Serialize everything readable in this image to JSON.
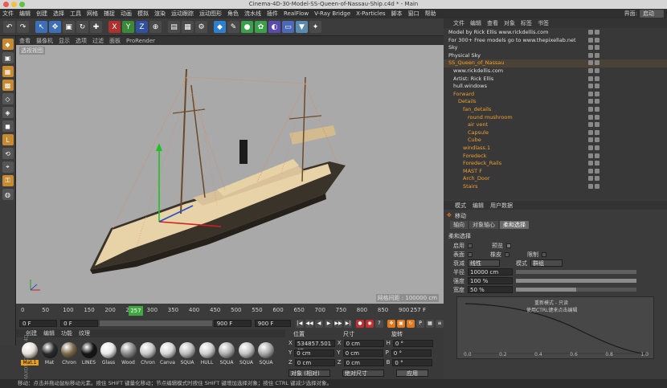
{
  "window": {
    "title": "Cinema-4D-30-Model-SS-Queen-of-Nassau-Ship.c4d * - Main"
  },
  "menubar": {
    "items": [
      "文件",
      "编辑",
      "创建",
      "选择",
      "工具",
      "网格",
      "捕捉",
      "动画",
      "模拟",
      "渲染",
      "运动跟踪",
      "运动图形",
      "角色",
      "流水线",
      "插件",
      "RealFlow",
      "V-Ray Bridge",
      "X-Particles",
      "脚本",
      "窗口",
      "帮助"
    ],
    "layout_label": "界面:",
    "layout_value": "启动"
  },
  "viewport": {
    "menu": [
      "查看",
      "摄像机",
      "显示",
      "选项",
      "过滤",
      "面板",
      "ProRender"
    ],
    "label": "透视视图",
    "grid_spacing": "网格间距 : 100000 cm"
  },
  "timeline": {
    "ticks": [
      "0",
      "50",
      "100",
      "150",
      "200",
      "250",
      "300",
      "350",
      "400",
      "450",
      "500",
      "550",
      "600",
      "650",
      "700",
      "750",
      "800",
      "850",
      "900"
    ],
    "current_frame": "257",
    "end_frame_display": "257 F",
    "start_field": "0 F",
    "range_start": "0 F",
    "range_end": "900 F",
    "max_field": "900 F",
    "playhead_fraction": 0.2856
  },
  "materials": {
    "menu": [
      "创建",
      "编辑",
      "功能",
      "纹理"
    ],
    "items": [
      {
        "label": "Mat.1",
        "color": "#e7e2d8"
      },
      {
        "label": "Mat",
        "color": "#2a2a2a"
      },
      {
        "label": "Chron",
        "color": "#7a6a4a"
      },
      {
        "label": "LINES",
        "color": "#151515"
      },
      {
        "label": "Glass",
        "color": "#e8e8e8"
      },
      {
        "label": "Wood",
        "color": "#8a8a8a"
      },
      {
        "label": "Chron",
        "color": "#c9c9c9"
      },
      {
        "label": "Canva",
        "color": "#d6d6d6"
      },
      {
        "label": "SQUA",
        "color": "#bdbdbd"
      },
      {
        "label": "HULL",
        "color": "#cfcfcf"
      },
      {
        "label": "SQUA",
        "color": "#b0b0b0"
      },
      {
        "label": "SQUA",
        "color": "#c4c4c4"
      },
      {
        "label": "SQUA",
        "color": "#a9a9a9"
      }
    ],
    "brand": "MAXON CINEMA 4D"
  },
  "coordinates": {
    "headers": {
      "position": "位置",
      "size": "尺寸",
      "rotation": "旋转"
    },
    "rows": [
      {
        "axis": "X",
        "pos": "534857.501 cn",
        "size_axis": "X",
        "size": "0 cm",
        "rot_axis": "H",
        "rot": "0 °"
      },
      {
        "axis": "Y",
        "pos": "0 cm",
        "size_axis": "Y",
        "size": "0 cm",
        "rot_axis": "P",
        "rot": "0 °"
      },
      {
        "axis": "Z",
        "pos": "0 cm",
        "size_axis": "Z",
        "size": "0 cm",
        "rot_axis": "B",
        "rot": "0 °"
      }
    ],
    "mode_select": "对象 (相对)",
    "size_select": "绝对尺寸",
    "apply_button": "应用"
  },
  "status": {
    "text": "移动：点击并拖动鼠标移动元素。按住 SHIFT 键量化移动；节点编辑模式时按住 SHIFT 键增加选择对象；按住 CTRL 键减少选择对象。"
  },
  "object_manager": {
    "menu": [
      "文件",
      "编辑",
      "查看",
      "对象",
      "标签",
      "书签"
    ],
    "objects": [
      {
        "name": "Model by Rick Ellis www.rickdellis.com",
        "indent": 0,
        "color": "#e0e0e0"
      },
      {
        "name": "For 300+ Free models go to www.thepixellab.net",
        "indent": 0,
        "color": "#e0e0e0"
      },
      {
        "name": "Sky",
        "indent": 0,
        "color": "#e0e0e0"
      },
      {
        "name": "Physical Sky",
        "indent": 0,
        "color": "#e0e0e0"
      },
      {
        "name": "SS_Queen_of_Nassau",
        "indent": 0,
        "color": "#f0a030"
      },
      {
        "name": "www.rickdellis.com",
        "indent": 1,
        "color": "#e0e0e0"
      },
      {
        "name": "Artist: Rick Ellis",
        "indent": 1,
        "color": "#e0e0e0"
      },
      {
        "name": "hull.windows",
        "indent": 1,
        "color": "#e0e0e0"
      },
      {
        "name": "Forward",
        "indent": 1,
        "color": "#f0a030"
      },
      {
        "name": "Details",
        "indent": 2,
        "color": "#f0a030"
      },
      {
        "name": "fan_details",
        "indent": 3,
        "color": "#f0a030"
      },
      {
        "name": "round mushroom",
        "indent": 4,
        "color": "#f0a030"
      },
      {
        "name": "air vent",
        "indent": 4,
        "color": "#f0a030"
      },
      {
        "name": "Capsule",
        "indent": 4,
        "color": "#f0a030"
      },
      {
        "name": "Cube",
        "indent": 4,
        "color": "#f0a030"
      },
      {
        "name": "windlass.1",
        "indent": 3,
        "color": "#f0a030"
      },
      {
        "name": "Foredeck",
        "indent": 3,
        "color": "#f0a030"
      },
      {
        "name": "Foredeck_Rails",
        "indent": 3,
        "color": "#f0a030"
      },
      {
        "name": "MAST F",
        "indent": 3,
        "color": "#f0a030"
      },
      {
        "name": "Arch_Door",
        "indent": 3,
        "color": "#f0a030"
      },
      {
        "name": "Stairs",
        "indent": 3,
        "color": "#f0a030"
      }
    ]
  },
  "attributes": {
    "menu": [
      "模式",
      "编辑",
      "用户数据"
    ],
    "tool_title": "移动",
    "tabs": [
      "轴向",
      "对象轴心",
      "柔和选择"
    ],
    "section": "柔和选择",
    "rows": {
      "enable": "启用",
      "preview": "预览",
      "surface": "表面",
      "rubber": "橡皮",
      "restrict": "限制",
      "falloff_label": "衰减",
      "falloff_value": "线性",
      "mode_label": "模式",
      "mode_value": "群组",
      "radius_label": "半径",
      "radius_value": "10000 cm",
      "strength_label": "强度",
      "strength_value": "100 %",
      "width_label": "宽度",
      "width_value": "50 %"
    },
    "graph_note_1": "重新模式 - 只读",
    "graph_note_2": "使用CTRL键来点击编辑",
    "graph_x_ticks": [
      "0.0",
      "0.2",
      "0.4",
      "0.6",
      "0.8",
      "1.0"
    ]
  }
}
